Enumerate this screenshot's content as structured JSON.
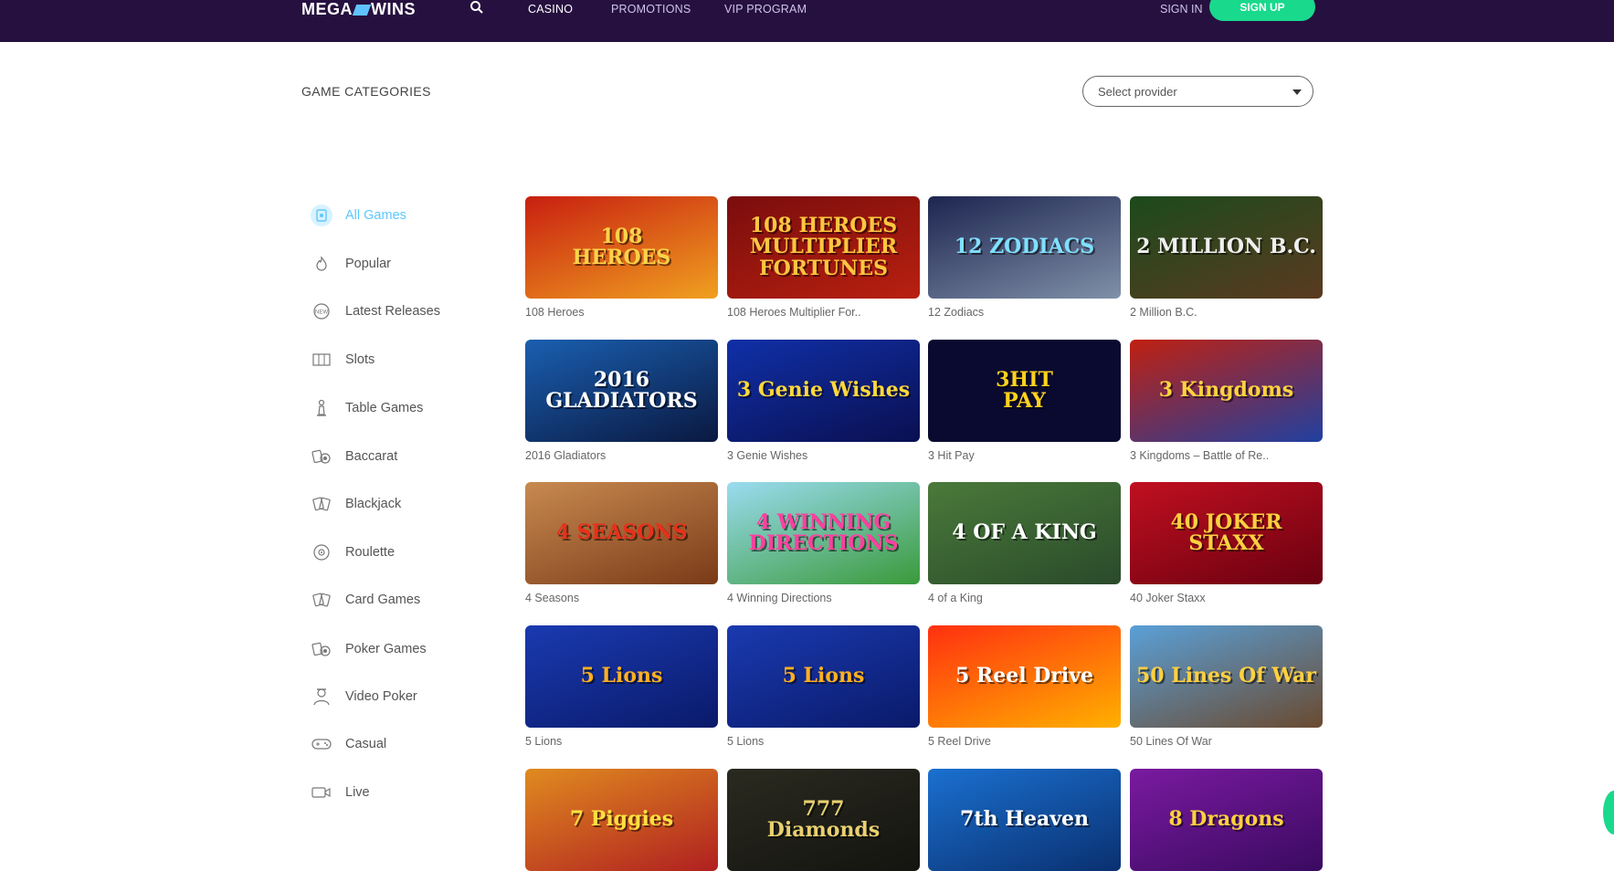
{
  "header": {
    "logo_text_left": "MEGA",
    "logo_text_right": "WINS",
    "nav": [
      "CASINO",
      "PROMOTIONS",
      "VIP PROGRAM"
    ],
    "sign_in": "SIGN IN",
    "sign_up": "SIGN UP"
  },
  "categories_heading": "GAME CATEGORIES",
  "provider_select": {
    "placeholder": "Select provider"
  },
  "sidebar": {
    "items": [
      {
        "label": "All Games",
        "icon": "all-games-icon"
      },
      {
        "label": "Popular",
        "icon": "flame-icon"
      },
      {
        "label": "Latest Releases",
        "icon": "new-badge-icon"
      },
      {
        "label": "Slots",
        "icon": "slot-reels-icon"
      },
      {
        "label": "Table Games",
        "icon": "chess-piece-icon"
      },
      {
        "label": "Baccarat",
        "icon": "cards-chip-icon"
      },
      {
        "label": "Blackjack",
        "icon": "cards-icon"
      },
      {
        "label": "Roulette",
        "icon": "roulette-wheel-icon"
      },
      {
        "label": "Card Games",
        "icon": "cards-icon"
      },
      {
        "label": "Poker Games",
        "icon": "cards-chip-icon"
      },
      {
        "label": "Video Poker",
        "icon": "dealer-icon"
      },
      {
        "label": "Casual",
        "icon": "gamepad-icon"
      },
      {
        "label": "Live",
        "icon": "video-camera-icon"
      }
    ]
  },
  "games": [
    {
      "label": "108 Heroes",
      "thumb_text": "108\nHEROES",
      "colors": [
        "#c81f10",
        "#f0a020"
      ],
      "text_color": "#ffd24a"
    },
    {
      "label": "108 Heroes Multiplier For..",
      "thumb_text": "108 HEROES\nMULTIPLIER\nFORTUNES",
      "colors": [
        "#7a0d0d",
        "#b82010"
      ],
      "text_color": "#ffc640"
    },
    {
      "label": "12 Zodiacs",
      "thumb_text": "12 ZODIACS",
      "colors": [
        "#1d2550",
        "#8090a8"
      ],
      "text_color": "#7fe0ff"
    },
    {
      "label": "2 Million B.C.",
      "thumb_text": "2 MILLION B.C.",
      "colors": [
        "#1c4a1c",
        "#5a3a20"
      ],
      "text_color": "#f0f0f0"
    },
    {
      "label": "2016 Gladiators",
      "thumb_text": "2016 GLADIATORS",
      "colors": [
        "#1a5fb0",
        "#0a1840"
      ],
      "text_color": "#ffffff"
    },
    {
      "label": "3 Genie Wishes",
      "thumb_text": "3 Genie Wishes",
      "colors": [
        "#1030a8",
        "#0a0f50"
      ],
      "text_color": "#ffd83a"
    },
    {
      "label": "3 Hit Pay",
      "thumb_text": "3HIT\nPAY",
      "colors": [
        "#0a0a30",
        "#0a0a30"
      ],
      "text_color": "#ffd21e"
    },
    {
      "label": "3 Kingdoms – Battle of Re..",
      "thumb_text": "3 Kingdoms",
      "colors": [
        "#c02010",
        "#2040a0"
      ],
      "text_color": "#ffd240"
    },
    {
      "label": "4 Seasons",
      "thumb_text": "4 SEASONS",
      "colors": [
        "#c88a50",
        "#7a3a18"
      ],
      "text_color": "#e8301a"
    },
    {
      "label": "4 Winning Directions",
      "thumb_text": "4 WINNING DIRECTIONS",
      "colors": [
        "#9adcf0",
        "#3a9a3a"
      ],
      "text_color": "#ff40a0"
    },
    {
      "label": "4 of a King",
      "thumb_text": "4 OF A KING",
      "colors": [
        "#4a7a3a",
        "#2a4a2a"
      ],
      "text_color": "#ffffff"
    },
    {
      "label": "40 Joker Staxx",
      "thumb_text": "40 JOKER\nSTAXX",
      "colors": [
        "#c01020",
        "#6a0010"
      ],
      "text_color": "#ffd040"
    },
    {
      "label": "5 Lions",
      "thumb_text": "5 Lions",
      "colors": [
        "#1a3ab0",
        "#0a1a6a"
      ],
      "text_color": "#ffb020"
    },
    {
      "label": "5 Lions",
      "thumb_text": "5 Lions",
      "colors": [
        "#1a3ab0",
        "#0a1a6a"
      ],
      "text_color": "#ffb020"
    },
    {
      "label": "5 Reel Drive",
      "thumb_text": "5 Reel Drive",
      "colors": [
        "#ff3010",
        "#ffb000"
      ],
      "text_color": "#ffffff"
    },
    {
      "label": "50 Lines Of War",
      "thumb_text": "50 Lines Of War",
      "colors": [
        "#5aa0d8",
        "#6a4a30"
      ],
      "text_color": "#ffd040"
    },
    {
      "label": "",
      "thumb_text": "7 Piggies",
      "colors": [
        "#e08a20",
        "#b02020"
      ],
      "text_color": "#ffe040"
    },
    {
      "label": "",
      "thumb_text": "777\nDiamonds",
      "colors": [
        "#2a2a20",
        "#141410"
      ],
      "text_color": "#e8d070"
    },
    {
      "label": "",
      "thumb_text": "7th Heaven",
      "colors": [
        "#1a70d0",
        "#0a3070"
      ],
      "text_color": "#ffffff"
    },
    {
      "label": "",
      "thumb_text": "8 Dragons",
      "colors": [
        "#7a1aa0",
        "#3a0a60"
      ],
      "text_color": "#ffd040"
    }
  ]
}
